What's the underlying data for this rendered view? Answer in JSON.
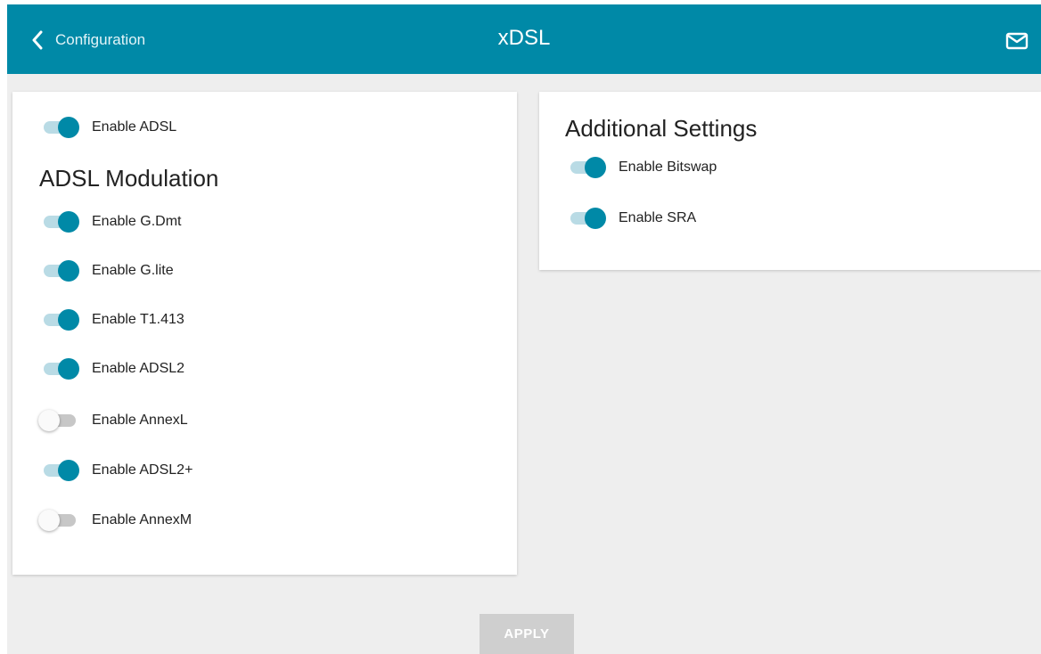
{
  "header": {
    "back_label": "Configuration",
    "title": "xDSL",
    "mail_icon": "mail-icon",
    "back_icon": "chevron-left-icon"
  },
  "colors": {
    "header_bg": "#0089a7",
    "toggle_on": "#0089a7",
    "toggle_off": "#c7c7c7",
    "content_bg": "#eeeeee",
    "apply_disabled": "#cfcfcf"
  },
  "left_panel": {
    "enable_adsl": {
      "label": "Enable ADSL",
      "on": true
    },
    "modulation_heading": "ADSL Modulation",
    "modulations": [
      {
        "label": "Enable G.Dmt",
        "on": true
      },
      {
        "label": "Enable G.lite",
        "on": true
      },
      {
        "label": "Enable T1.413",
        "on": true
      },
      {
        "label": "Enable ADSL2",
        "on": true
      },
      {
        "label": "Enable AnnexL",
        "on": false
      },
      {
        "label": "Enable ADSL2+",
        "on": true
      },
      {
        "label": "Enable AnnexM",
        "on": false
      }
    ]
  },
  "right_panel": {
    "heading": "Additional Settings",
    "settings": [
      {
        "label": "Enable Bitswap",
        "on": true
      },
      {
        "label": "Enable SRA",
        "on": true
      }
    ]
  },
  "footer": {
    "apply_label": "APPLY"
  }
}
